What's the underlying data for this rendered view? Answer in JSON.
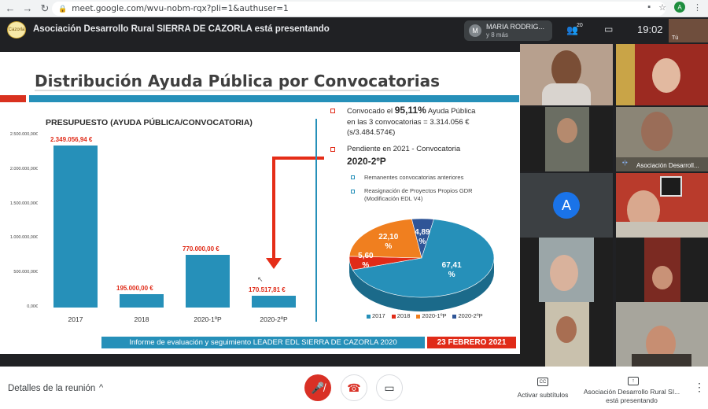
{
  "browser": {
    "url": "meet.google.com/wvu-nobm-rqx?pli=1&authuser=1",
    "profile_initial": "A",
    "back_icon": "arrow-left-icon",
    "forward_icon": "arrow-right-icon",
    "reload_icon": "reload-icon"
  },
  "meet_top": {
    "presenting_text": "Asociación Desarrollo Rural SIERRA DE CAZORLA está presentando",
    "logo_text": "Cazorla",
    "participant_initial": "M",
    "participant_name": "MARIA RODRIG...",
    "participant_more": "y 8 más",
    "people_count": "20",
    "time": "19:02",
    "self_label": "Tú"
  },
  "slide": {
    "title": "Distribución Ayuda Pública por Convocatorias",
    "footer_left": "Informe de evaluación y seguimiento LEADER EDL SIERRA DE CAZORLA 2020",
    "footer_right": "23 FEBRERO 2021",
    "right_panel": {
      "line1_pre": "Convocado el ",
      "line1_bold": "95,11%",
      "line1_post": " Ayuda Pública",
      "line2": "en las 3 convocatorias = 3.314.056 €",
      "line3": "(s/3.484.574€)",
      "line4": "Pendiente en 2021 - Convocatoria",
      "line5": "2020-2ºP",
      "sub1": "Remanentes convocatorias anteriores",
      "sub2a": "Reasignación de Proyectos Propios GDR",
      "sub2b": "(Modificación EDL V4)"
    },
    "colors": {
      "blue": "#2690b9",
      "red": "#e02b18",
      "orange": "#f07f1f",
      "navy": "#2f5597"
    }
  },
  "chart_data": [
    {
      "type": "bar",
      "title": "PRESUPUESTO (AYUDA PÚBLICA/CONVOCATORIA)",
      "categories": [
        "2017",
        "2018",
        "2020-1ºP",
        "2020-2ºP"
      ],
      "values": [
        2349056.94,
        195000.0,
        770000.0,
        170517.81
      ],
      "value_labels": [
        "2.349.056,94 €",
        "195.000,00 €",
        "770.000,00 €",
        "170.517,81 €"
      ],
      "yticks": [
        "0,00€",
        "500.000,00€",
        "1.000.000,00€",
        "1.500.000,00€",
        "2.000.000,00€",
        "2.500.000,00€"
      ],
      "ylim": [
        0,
        2500000
      ]
    },
    {
      "type": "pie",
      "labels": [
        "2017",
        "2018",
        "2020-1ºP",
        "2020-2ºP"
      ],
      "values": [
        67.41,
        5.6,
        22.1,
        4.89
      ],
      "value_labels": [
        "67,41 %",
        "5,60 %",
        "22,10 %",
        "4,89 %"
      ],
      "colors": [
        "#2690b9",
        "#e02b18",
        "#f07f1f",
        "#2f5597"
      ],
      "legend_position": "bottom"
    }
  ],
  "tiles": {
    "presenter_name": "Asociación Desarroll...",
    "avatar_initial": "A"
  },
  "bottom": {
    "details": "Detalles de la reunión",
    "captions": "Activar subtítulos",
    "captions_icon_text": "CC",
    "presenting_line1": "Asociación Desarrollo Rural SI...",
    "presenting_line2": "está presentando"
  }
}
